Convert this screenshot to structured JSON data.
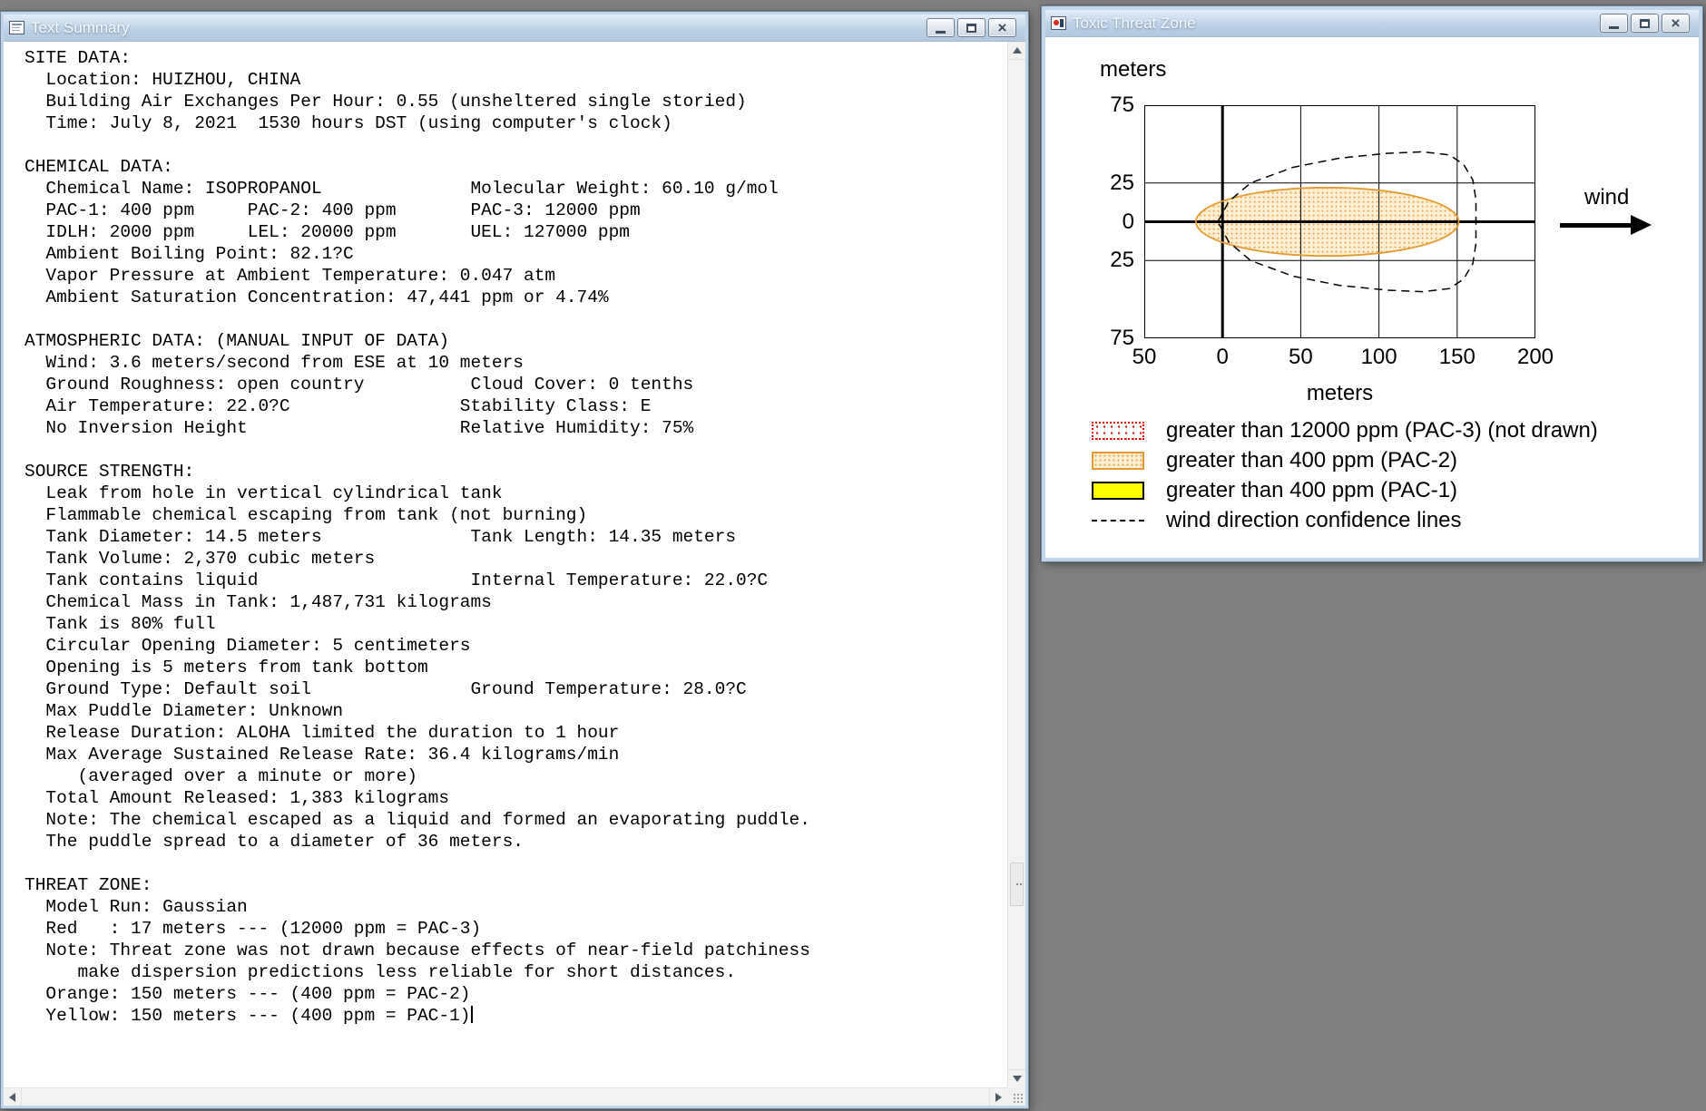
{
  "desktop": {
    "background_color": "#808080"
  },
  "text_summary_window": {
    "title": "Text Summary",
    "window_buttons": [
      "minimize",
      "maximize",
      "close"
    ],
    "caret_at_end": true,
    "lines": [
      "SITE DATA:",
      "  Location: HUIZHOU, CHINA",
      "  Building Air Exchanges Per Hour: 0.55 (unsheltered single storied)",
      "  Time: July 8, 2021  1530 hours DST (using computer's clock)",
      "",
      "CHEMICAL DATA:",
      "  Chemical Name: ISOPROPANOL              Molecular Weight: 60.10 g/mol",
      "  PAC-1: 400 ppm     PAC-2: 400 ppm       PAC-3: 12000 ppm",
      "  IDLH: 2000 ppm     LEL: 20000 ppm       UEL: 127000 ppm",
      "  Ambient Boiling Point: 82.1?C",
      "  Vapor Pressure at Ambient Temperature: 0.047 atm",
      "  Ambient Saturation Concentration: 47,441 ppm or 4.74%",
      "",
      "ATMOSPHERIC DATA: (MANUAL INPUT OF DATA)",
      "  Wind: 3.6 meters/second from ESE at 10 meters",
      "  Ground Roughness: open country          Cloud Cover: 0 tenths",
      "  Air Temperature: 22.0?C                Stability Class: E",
      "  No Inversion Height                    Relative Humidity: 75%",
      "",
      "SOURCE STRENGTH:",
      "  Leak from hole in vertical cylindrical tank",
      "  Flammable chemical escaping from tank (not burning)",
      "  Tank Diameter: 14.5 meters              Tank Length: 14.35 meters",
      "  Tank Volume: 2,370 cubic meters",
      "  Tank contains liquid                    Internal Temperature: 22.0?C",
      "  Chemical Mass in Tank: 1,487,731 kilograms",
      "  Tank is 80% full",
      "  Circular Opening Diameter: 5 centimeters",
      "  Opening is 5 meters from tank bottom",
      "  Ground Type: Default soil               Ground Temperature: 28.0?C",
      "  Max Puddle Diameter: Unknown",
      "  Release Duration: ALOHA limited the duration to 1 hour",
      "  Max Average Sustained Release Rate: 36.4 kilograms/min",
      "     (averaged over a minute or more)",
      "  Total Amount Released: 1,383 kilograms",
      "  Note: The chemical escaped as a liquid and formed an evaporating puddle.",
      "  The puddle spread to a diameter of 36 meters.",
      "",
      "THREAT ZONE:",
      "  Model Run: Gaussian",
      "  Red   : 17 meters --- (12000 ppm = PAC-3)",
      "  Note: Threat zone was not drawn because effects of near-field patchiness",
      "     make dispersion predictions less reliable for short distances.",
      "  Orange: 150 meters --- (400 ppm = PAC-2)",
      "  Yellow: 150 meters --- (400 ppm = PAC-1)"
    ]
  },
  "toxic_threat_zone_window": {
    "title": "Toxic Threat Zone",
    "window_buttons": [
      "minimize",
      "maximize",
      "close"
    ],
    "wind_label": "wind",
    "legend": [
      {
        "swatch": "pac3",
        "label": "greater than 12000 ppm (PAC-3) (not drawn)"
      },
      {
        "swatch": "pac2",
        "label": "greater than 400 ppm (PAC-2)"
      },
      {
        "swatch": "pac1",
        "label": "greater than 400 ppm (PAC-1)"
      },
      {
        "swatch": "dashed",
        "label": "wind direction confidence lines"
      }
    ],
    "colors": {
      "pac3_red": "#e00000",
      "pac2_border": "#e59b33",
      "pac2_fill": "#fcefd2",
      "pac2_dot": "#eca24a",
      "pac1_yellow": "#ffff00",
      "axis_black": "#000000"
    }
  },
  "chart_data": {
    "type": "area",
    "title": "Toxic Threat Zone",
    "grid": true,
    "x_axis": {
      "label": "meters",
      "range_m": [
        -50,
        200
      ],
      "ticks": [
        {
          "value": -50,
          "label": "50"
        },
        {
          "value": 0,
          "label": "0"
        },
        {
          "value": 50,
          "label": "50"
        },
        {
          "value": 100,
          "label": "100"
        },
        {
          "value": 150,
          "label": "150"
        },
        {
          "value": 200,
          "label": "200"
        }
      ]
    },
    "y_axis": {
      "label": "meters",
      "range_m": [
        -75,
        75
      ],
      "ticks": [
        {
          "value": 75,
          "label": "75"
        },
        {
          "value": 25,
          "label": "25"
        },
        {
          "value": 0,
          "label": "0"
        },
        {
          "value": -25,
          "label": "25"
        },
        {
          "value": -75,
          "label": "75"
        }
      ]
    },
    "wind_direction": "left-to-right",
    "zones": {
      "pac3_red": {
        "downwind_extent_m": 17,
        "drawn": false
      },
      "pac2_orange": {
        "downwind_extent_m": 150,
        "ellipse": {
          "cx_m": 67,
          "cy_m": 0,
          "rx_m": 84,
          "ry_m": 22
        }
      },
      "pac1_yellow": {
        "downwind_extent_m": 150,
        "coincides_with_pac2": true
      },
      "confidence_outline_m": [
        [
          -3,
          0
        ],
        [
          4,
          13
        ],
        [
          18,
          25
        ],
        [
          45,
          35
        ],
        [
          75,
          41
        ],
        [
          105,
          44
        ],
        [
          128,
          45
        ],
        [
          145,
          43
        ],
        [
          154,
          37
        ],
        [
          160,
          27
        ],
        [
          162,
          14
        ],
        [
          162,
          -14
        ],
        [
          160,
          -27
        ],
        [
          154,
          -37
        ],
        [
          145,
          -43
        ],
        [
          128,
          -45
        ],
        [
          105,
          -44
        ],
        [
          75,
          -41
        ],
        [
          45,
          -35
        ],
        [
          18,
          -25
        ],
        [
          4,
          -13
        ],
        [
          -3,
          0
        ]
      ]
    }
  }
}
